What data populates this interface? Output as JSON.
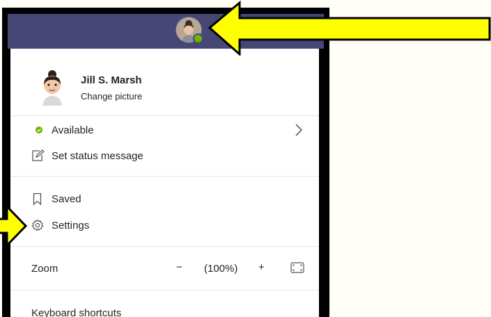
{
  "profile": {
    "name": "Jill S. Marsh",
    "change_picture": "Change picture"
  },
  "status": {
    "available": "Available",
    "set_status": "Set status message"
  },
  "menu": {
    "saved": "Saved",
    "settings": "Settings"
  },
  "zoom": {
    "label": "Zoom",
    "minus": "−",
    "value": "(100%)",
    "plus": "+"
  },
  "footer": {
    "keyboard_shortcuts": "Keyboard shortcuts"
  },
  "colors": {
    "header": "#464775",
    "available": "#6bb700",
    "arrow": "#ffff00"
  },
  "icons": [
    "avatar-icon",
    "status-available-icon",
    "chevron-right-icon",
    "edit-status-icon",
    "bookmark-icon",
    "gear-icon",
    "fullscreen-icon",
    "yellow-arrow"
  ]
}
